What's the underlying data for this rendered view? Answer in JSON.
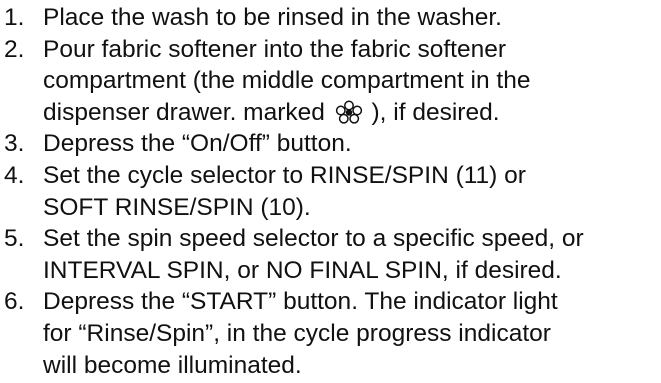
{
  "heading_fragment": "",
  "steps": [
    {
      "number": "1.",
      "lines": [
        "Place the wash to be rinsed in the washer."
      ]
    },
    {
      "number": "2.",
      "lines": [
        "Pour fabric softener into the fabric softener",
        "compartment (the middle compartment in the",
        "dispenser drawer. marked"
      ],
      "after_icon": "), if desired.",
      "icon": "flower-softener-icon"
    },
    {
      "number": "3.",
      "lines": [
        "Depress the “On/Off” button."
      ]
    },
    {
      "number": "4.",
      "lines": [
        "Set the cycle selector to RINSE/SPIN (11) or",
        "SOFT RINSE/SPIN (10)."
      ]
    },
    {
      "number": "5.",
      "lines": [
        "Set the spin speed selector to a specific speed, or",
        "INTERVAL SPIN, or NO FINAL SPIN, if desired."
      ]
    },
    {
      "number": "6.",
      "lines": [
        "Depress the “START” button. The indicator light",
        "for “Rinse/Spin”, in the cycle progress indicator",
        "will become illuminated."
      ]
    }
  ]
}
